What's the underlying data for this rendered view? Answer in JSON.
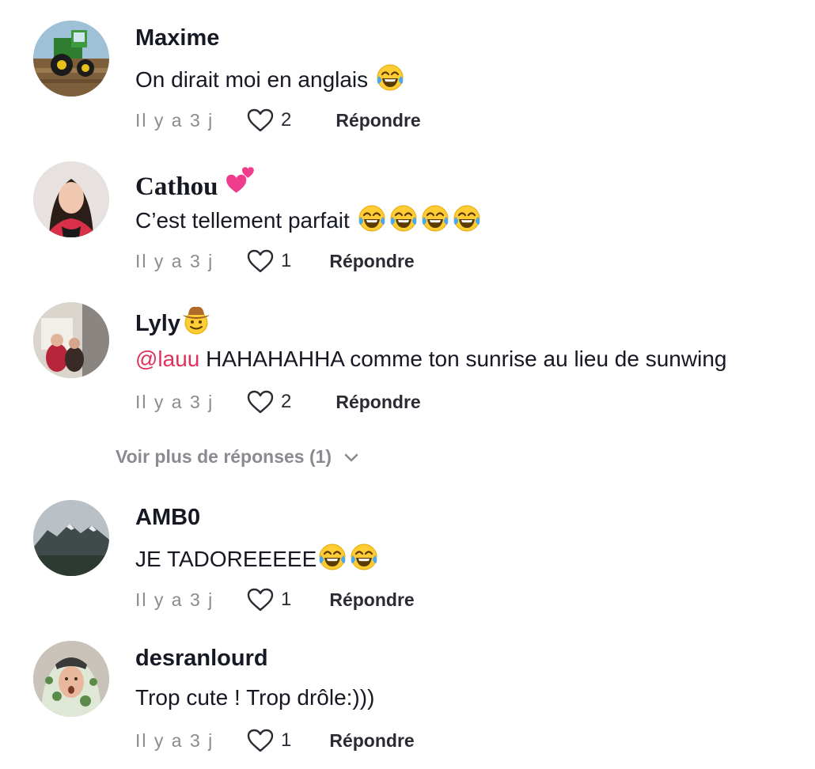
{
  "comments": [
    {
      "username": "Maxime",
      "text": "On dirait moi en anglais",
      "emoji_after_text": [
        "face-with-tears-of-joy-icon"
      ],
      "time": "Il y a 3 j",
      "likes": "2",
      "reply_label": "Répondre"
    },
    {
      "username": "Cathou",
      "username_emoji": "two-hearts-icon",
      "text": "C’est tellement parfait",
      "emoji_after_text": [
        "face-with-tears-of-joy-icon",
        "face-with-tears-of-joy-icon",
        "face-with-tears-of-joy-icon",
        "face-with-tears-of-joy-icon"
      ],
      "time": "Il y a 3 j",
      "likes": "1",
      "reply_label": "Répondre"
    },
    {
      "username": "Lyly",
      "username_emoji": "cowboy-hat-face-icon",
      "mention": "@lauu",
      "text": "HAHAHAHHA comme ton sunrise au lieu de sunwing",
      "time": "Il y a 3 j",
      "likes": "2",
      "reply_label": "Répondre"
    },
    {
      "username": "AMB0",
      "text": "JE TADOREEEEE",
      "emoji_after_text": [
        "face-with-tears-of-joy-icon",
        "face-with-tears-of-joy-icon"
      ],
      "time": "Il y a 3 j",
      "likes": "1",
      "reply_label": "Répondre"
    },
    {
      "username": "desranlourd",
      "text": "Trop cute ! Trop drôle:)))",
      "time": "Il y a 3 j",
      "likes": "1",
      "reply_label": "Répondre"
    }
  ],
  "more_replies": {
    "label": "Voir plus de réponses (1)",
    "icon": "chevron-down-icon"
  },
  "colors": {
    "text": "#161823",
    "muted": "#8a8b91",
    "mention": "#e0315b"
  }
}
